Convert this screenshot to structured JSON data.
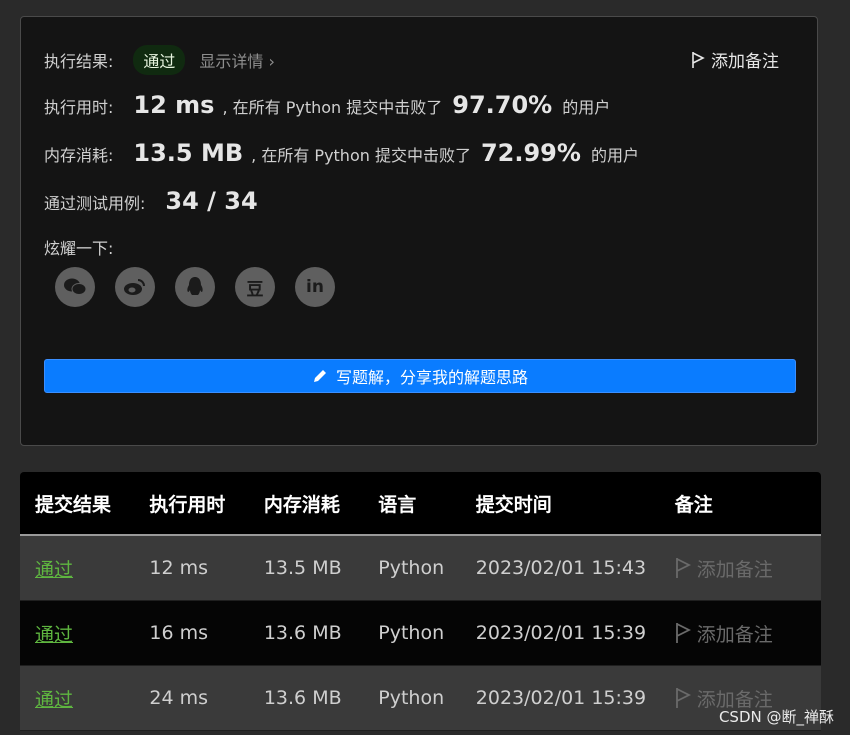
{
  "summary": {
    "result_label": "执行结果:",
    "result_badge": "通过",
    "detail_link": "显示详情 ›",
    "add_note": "添加备注",
    "time_label": "执行用时:",
    "time_value": "12 ms",
    "time_text": ", 在所有 Python 提交中击败了",
    "time_pct": "97.70%",
    "time_suffix": "的用户",
    "mem_label": "内存消耗:",
    "mem_value": "13.5 MB",
    "mem_text": ", 在所有 Python 提交中击败了",
    "mem_pct": "72.99%",
    "mem_suffix": "的用户",
    "tests_label": "通过测试用例:",
    "tests_value": "34 / 34",
    "share_label": "炫耀一下:",
    "share_icons": [
      "wechat-icon",
      "weibo-icon",
      "qq-icon",
      "douban-icon",
      "linkedin-icon"
    ],
    "douban_glyph": "豆",
    "linkedin_glyph": "in",
    "write_solution": "写题解，分享我的解题思路"
  },
  "table": {
    "headers": [
      "提交结果",
      "执行用时",
      "内存消耗",
      "语言",
      "提交时间",
      "备注"
    ],
    "rows": [
      {
        "status": "通过",
        "time": "12 ms",
        "memory": "13.5 MB",
        "language": "Python",
        "submitted": "2023/02/01 15:43",
        "note": "添加备注"
      },
      {
        "status": "通过",
        "time": "16 ms",
        "memory": "13.6 MB",
        "language": "Python",
        "submitted": "2023/02/01 15:39",
        "note": "添加备注"
      },
      {
        "status": "通过",
        "time": "24 ms",
        "memory": "13.6 MB",
        "language": "Python",
        "submitted": "2023/02/01 15:39",
        "note": "添加备注"
      }
    ]
  },
  "watermark": "CSDN @断_禅酥",
  "colors": {
    "accent": "#0a7cff",
    "success": "#5fb640",
    "badge_bg": "#102a10"
  }
}
